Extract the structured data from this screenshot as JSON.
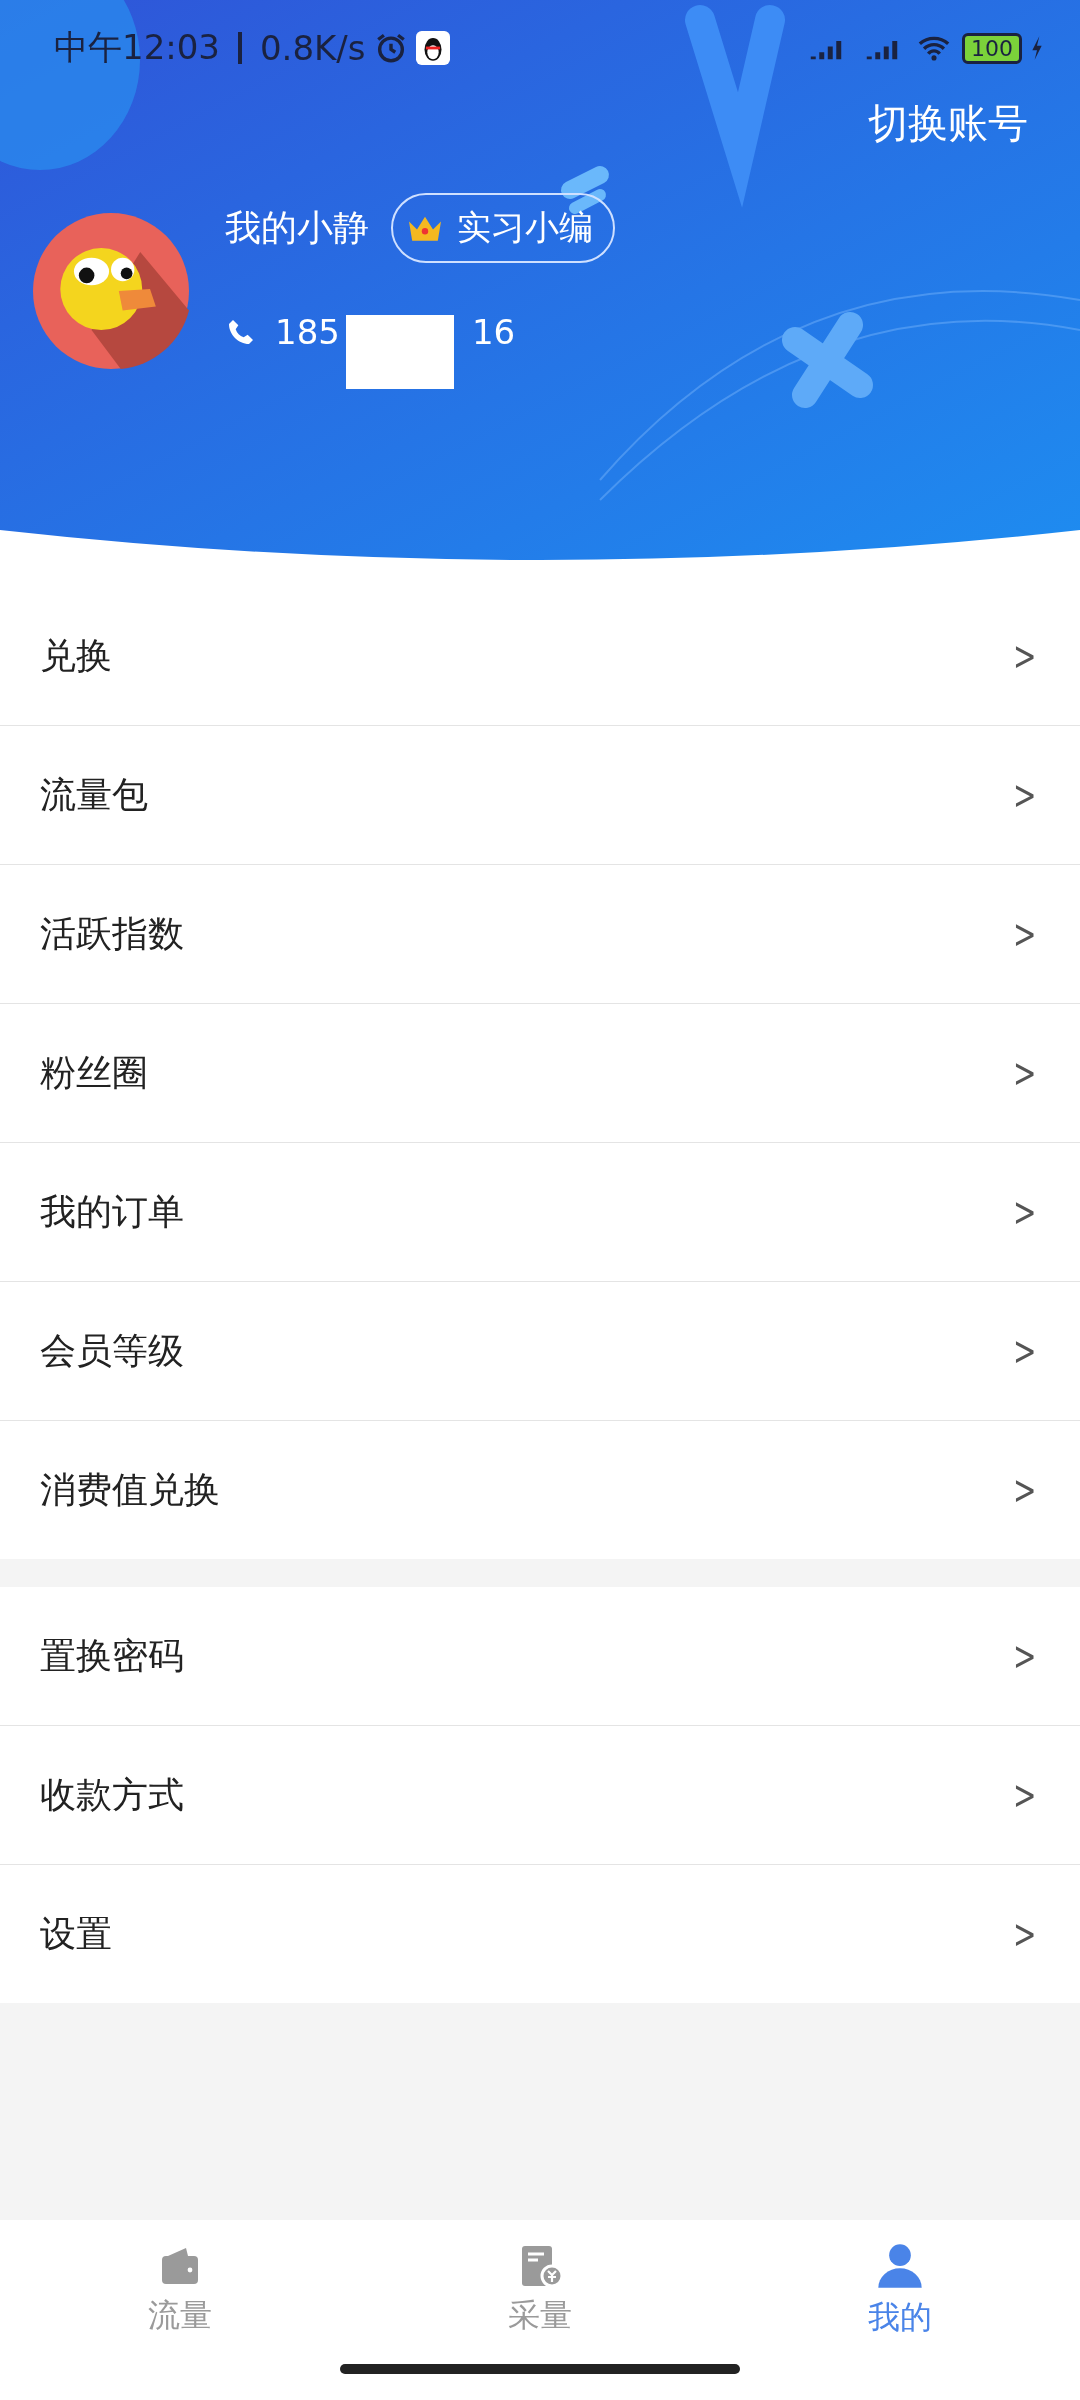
{
  "status_bar": {
    "time": "中午12:03",
    "speed": "0.8K/s",
    "battery": "100"
  },
  "header": {
    "switch_account": "切换账号",
    "name": "我的小静",
    "badge": "实习小编",
    "phone_prefix": "185",
    "phone_suffix": "16"
  },
  "menu_groups": [
    {
      "items": [
        {
          "label": "兑换",
          "chevron": ">"
        },
        {
          "label": "流量包",
          "chevron": ">"
        },
        {
          "label": "活跃指数",
          "chevron": ">"
        },
        {
          "label": "粉丝圈",
          "chevron": ">"
        },
        {
          "label": "我的订单",
          "chevron": ">"
        },
        {
          "label": "会员等级",
          "chevron": ">"
        },
        {
          "label": "消费值兑换",
          "chevron": ">"
        }
      ]
    },
    {
      "items": [
        {
          "label": "置换密码",
          "chevron": ">"
        },
        {
          "label": "收款方式",
          "chevron": ">"
        },
        {
          "label": "设置",
          "chevron": ">"
        }
      ]
    }
  ],
  "tab_bar": [
    {
      "kind": "wallet",
      "label": "流量",
      "selected": false
    },
    {
      "kind": "bill",
      "label": "采量",
      "selected": false
    },
    {
      "kind": "person",
      "label": "我的",
      "selected": true
    }
  ]
}
